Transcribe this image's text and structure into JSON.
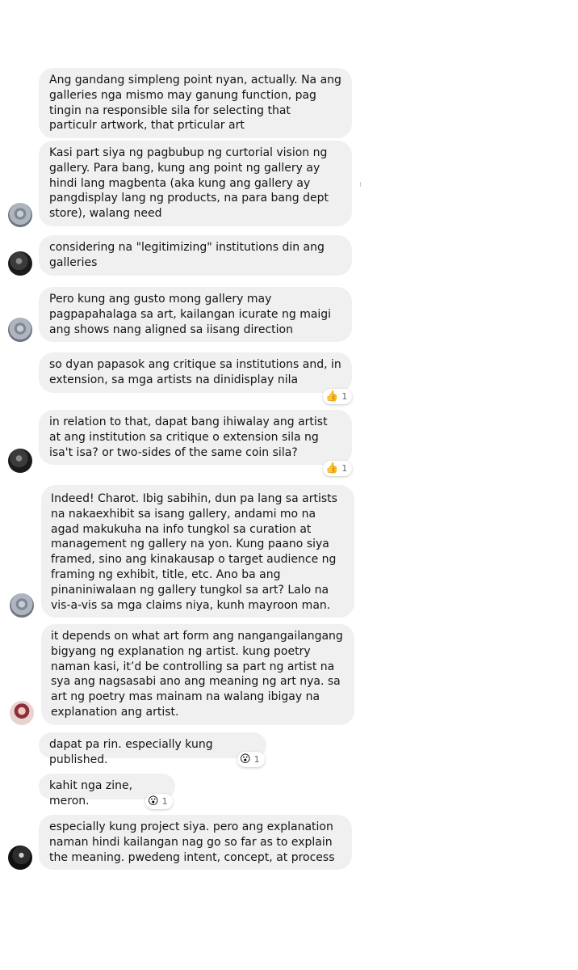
{
  "messages": [
    {
      "text": "Ang gandang simpleng point nyan, actually. Na ang galleries nga mismo may ganung function, pag tingin na responsible sila for selecting that particulr artwork, that prticular art"
    },
    {
      "text": "Kasi part siya ng pagbubup ng curtorial vision ng gallery. Para bang, kung ang point ng gallery ay hindi lang magbenta (aka kung ang gallery ay pangdisplay lang ng products, na para bang  dept store), walang need"
    },
    {
      "text": "considering na \"legitimizing\" institutions din ang galleries"
    },
    {
      "text": "Pero kung ang gusto mong gallery may pagpapahalaga sa art, kailangan icurate ng maigi ang shows nang aligned sa iisang direction"
    },
    {
      "text": "so dyan papasok ang critique sa institutions and, in extension, sa mga artists na dinidisplay nila",
      "reaction": {
        "emoji": "👍",
        "count": "1"
      }
    },
    {
      "text": "in relation to that, dapat bang ihiwalay ang artist at ang institution sa critique o extension sila ng isa't isa? or two-sides of the same coin sila?",
      "reaction": {
        "emoji": "👍",
        "count": "1"
      }
    },
    {
      "text": "Indeed! Charot. Ibig sabihin, dun pa lang sa artists na nakaexhibit sa isang gallery, andami mo na agad makukuha na info tungkol sa curation at management ng gallery na yon. Kung paano siya framed, sino ang kinakausap o target audience ng framing ng exhibit, title, etc. Ano ba ang pinaniniwalaan ng gallery tungkol sa art? Lalo na vis-a-vis sa mga claims niya, kunh mayroon man."
    },
    {
      "text": "it depends on what art form ang nangangailangang bigyang ng explanation ng artist. kung poetry naman kasi, it’d be controlling sa part ng artist na sya ang nagsasabi ano ang meaning ng art nya. sa art ng poetry mas mainam na walang ibigay na explanation ang artist."
    },
    {
      "text": "dapat pa rin. especially kung published.",
      "reaction": {
        "emoji": "😮",
        "count": "1"
      }
    },
    {
      "text": "kahit nga zine, meron.",
      "reaction": {
        "emoji": "😮",
        "count": "1"
      }
    },
    {
      "text": "especially kung project siya. pero ang explanation naman hindi kailangan nag go so far as to explain the meaning. pwedeng intent, concept, at process"
    }
  ],
  "avatars": [
    {
      "icon": "user-avatar-a"
    },
    {
      "icon": "user-avatar-b"
    },
    {
      "icon": "user-avatar-a"
    },
    {
      "icon": "user-avatar-b"
    },
    {
      "icon": "user-avatar-a"
    },
    {
      "icon": "user-avatar-c"
    },
    {
      "icon": "user-avatar-d"
    }
  ],
  "colors": {
    "bubble": "#f0f0f0",
    "text": "#141414",
    "reaction_count": "#65676b"
  }
}
